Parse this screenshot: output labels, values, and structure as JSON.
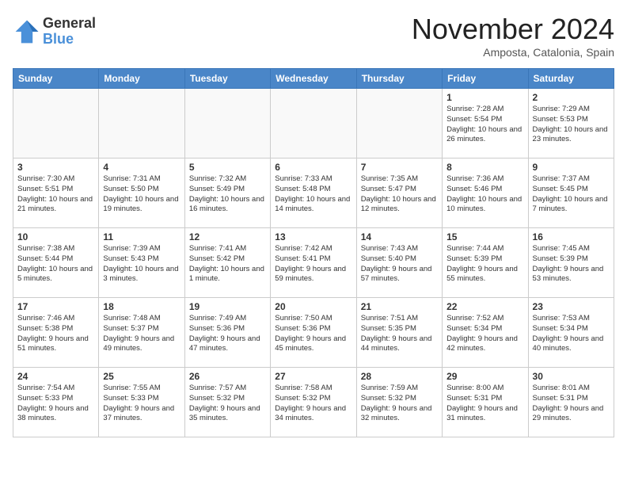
{
  "header": {
    "logo_general": "General",
    "logo_blue": "Blue",
    "month_title": "November 2024",
    "location": "Amposta, Catalonia, Spain"
  },
  "weekdays": [
    "Sunday",
    "Monday",
    "Tuesday",
    "Wednesday",
    "Thursday",
    "Friday",
    "Saturday"
  ],
  "weeks": [
    [
      {
        "day": "",
        "info": ""
      },
      {
        "day": "",
        "info": ""
      },
      {
        "day": "",
        "info": ""
      },
      {
        "day": "",
        "info": ""
      },
      {
        "day": "",
        "info": ""
      },
      {
        "day": "1",
        "info": "Sunrise: 7:28 AM\nSunset: 5:54 PM\nDaylight: 10 hours and 26 minutes."
      },
      {
        "day": "2",
        "info": "Sunrise: 7:29 AM\nSunset: 5:53 PM\nDaylight: 10 hours and 23 minutes."
      }
    ],
    [
      {
        "day": "3",
        "info": "Sunrise: 7:30 AM\nSunset: 5:51 PM\nDaylight: 10 hours and 21 minutes."
      },
      {
        "day": "4",
        "info": "Sunrise: 7:31 AM\nSunset: 5:50 PM\nDaylight: 10 hours and 19 minutes."
      },
      {
        "day": "5",
        "info": "Sunrise: 7:32 AM\nSunset: 5:49 PM\nDaylight: 10 hours and 16 minutes."
      },
      {
        "day": "6",
        "info": "Sunrise: 7:33 AM\nSunset: 5:48 PM\nDaylight: 10 hours and 14 minutes."
      },
      {
        "day": "7",
        "info": "Sunrise: 7:35 AM\nSunset: 5:47 PM\nDaylight: 10 hours and 12 minutes."
      },
      {
        "day": "8",
        "info": "Sunrise: 7:36 AM\nSunset: 5:46 PM\nDaylight: 10 hours and 10 minutes."
      },
      {
        "day": "9",
        "info": "Sunrise: 7:37 AM\nSunset: 5:45 PM\nDaylight: 10 hours and 7 minutes."
      }
    ],
    [
      {
        "day": "10",
        "info": "Sunrise: 7:38 AM\nSunset: 5:44 PM\nDaylight: 10 hours and 5 minutes."
      },
      {
        "day": "11",
        "info": "Sunrise: 7:39 AM\nSunset: 5:43 PM\nDaylight: 10 hours and 3 minutes."
      },
      {
        "day": "12",
        "info": "Sunrise: 7:41 AM\nSunset: 5:42 PM\nDaylight: 10 hours and 1 minute."
      },
      {
        "day": "13",
        "info": "Sunrise: 7:42 AM\nSunset: 5:41 PM\nDaylight: 9 hours and 59 minutes."
      },
      {
        "day": "14",
        "info": "Sunrise: 7:43 AM\nSunset: 5:40 PM\nDaylight: 9 hours and 57 minutes."
      },
      {
        "day": "15",
        "info": "Sunrise: 7:44 AM\nSunset: 5:39 PM\nDaylight: 9 hours and 55 minutes."
      },
      {
        "day": "16",
        "info": "Sunrise: 7:45 AM\nSunset: 5:39 PM\nDaylight: 9 hours and 53 minutes."
      }
    ],
    [
      {
        "day": "17",
        "info": "Sunrise: 7:46 AM\nSunset: 5:38 PM\nDaylight: 9 hours and 51 minutes."
      },
      {
        "day": "18",
        "info": "Sunrise: 7:48 AM\nSunset: 5:37 PM\nDaylight: 9 hours and 49 minutes."
      },
      {
        "day": "19",
        "info": "Sunrise: 7:49 AM\nSunset: 5:36 PM\nDaylight: 9 hours and 47 minutes."
      },
      {
        "day": "20",
        "info": "Sunrise: 7:50 AM\nSunset: 5:36 PM\nDaylight: 9 hours and 45 minutes."
      },
      {
        "day": "21",
        "info": "Sunrise: 7:51 AM\nSunset: 5:35 PM\nDaylight: 9 hours and 44 minutes."
      },
      {
        "day": "22",
        "info": "Sunrise: 7:52 AM\nSunset: 5:34 PM\nDaylight: 9 hours and 42 minutes."
      },
      {
        "day": "23",
        "info": "Sunrise: 7:53 AM\nSunset: 5:34 PM\nDaylight: 9 hours and 40 minutes."
      }
    ],
    [
      {
        "day": "24",
        "info": "Sunrise: 7:54 AM\nSunset: 5:33 PM\nDaylight: 9 hours and 38 minutes."
      },
      {
        "day": "25",
        "info": "Sunrise: 7:55 AM\nSunset: 5:33 PM\nDaylight: 9 hours and 37 minutes."
      },
      {
        "day": "26",
        "info": "Sunrise: 7:57 AM\nSunset: 5:32 PM\nDaylight: 9 hours and 35 minutes."
      },
      {
        "day": "27",
        "info": "Sunrise: 7:58 AM\nSunset: 5:32 PM\nDaylight: 9 hours and 34 minutes."
      },
      {
        "day": "28",
        "info": "Sunrise: 7:59 AM\nSunset: 5:32 PM\nDaylight: 9 hours and 32 minutes."
      },
      {
        "day": "29",
        "info": "Sunrise: 8:00 AM\nSunset: 5:31 PM\nDaylight: 9 hours and 31 minutes."
      },
      {
        "day": "30",
        "info": "Sunrise: 8:01 AM\nSunset: 5:31 PM\nDaylight: 9 hours and 29 minutes."
      }
    ]
  ]
}
